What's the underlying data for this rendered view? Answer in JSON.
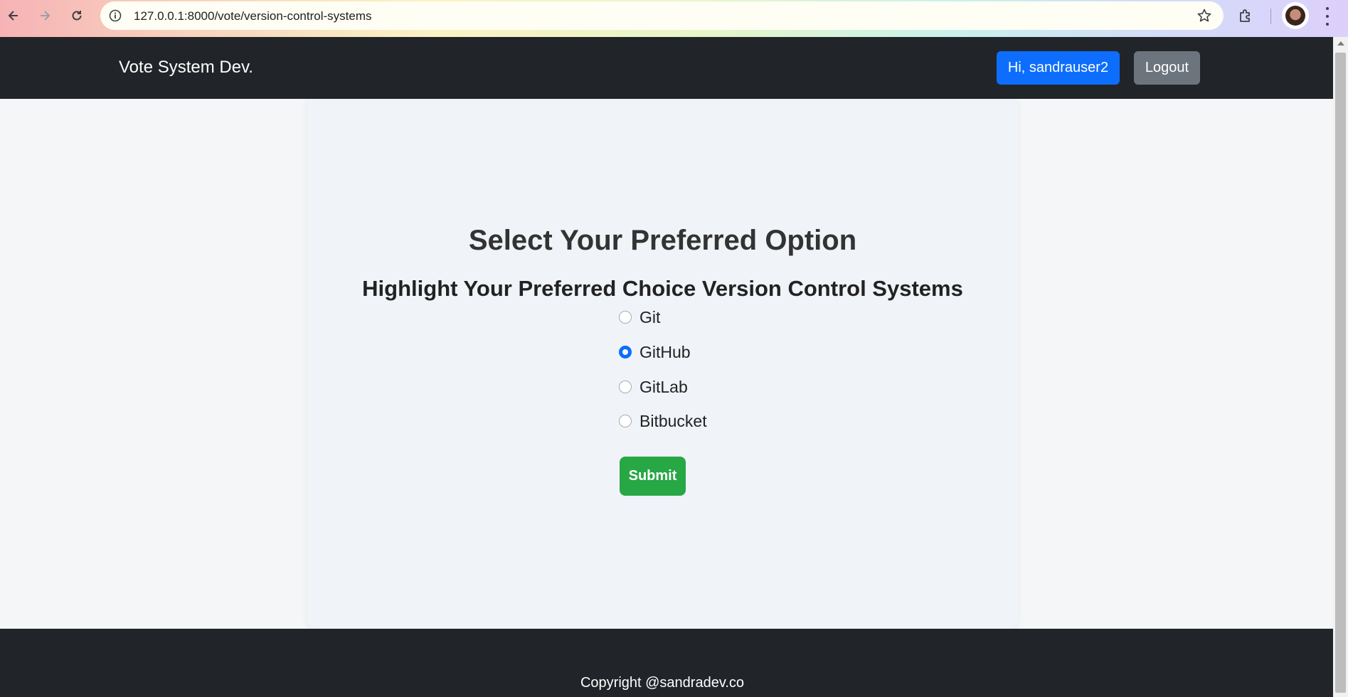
{
  "browser": {
    "url": "127.0.0.1:8000/vote/version-control-systems"
  },
  "navbar": {
    "brand": "Vote System Dev.",
    "greeting_button": "Hi, sandrauser2",
    "logout_button": "Logout"
  },
  "vote": {
    "title": "Select Your Preferred Option",
    "subtitle": "Highlight Your Preferred Choice Version Control Systems",
    "options": [
      {
        "label": "Git",
        "checked": false
      },
      {
        "label": "GitHub",
        "checked": true
      },
      {
        "label": "GitLab",
        "checked": false
      },
      {
        "label": "Bitbucket",
        "checked": false
      }
    ],
    "submit_label": "Submit"
  },
  "footer": {
    "copyright": "Copyright @sandradev.co"
  },
  "colors": {
    "navbar_bg": "#212529",
    "primary": "#0d6efd",
    "secondary": "#6c757d",
    "success": "#28a745"
  }
}
